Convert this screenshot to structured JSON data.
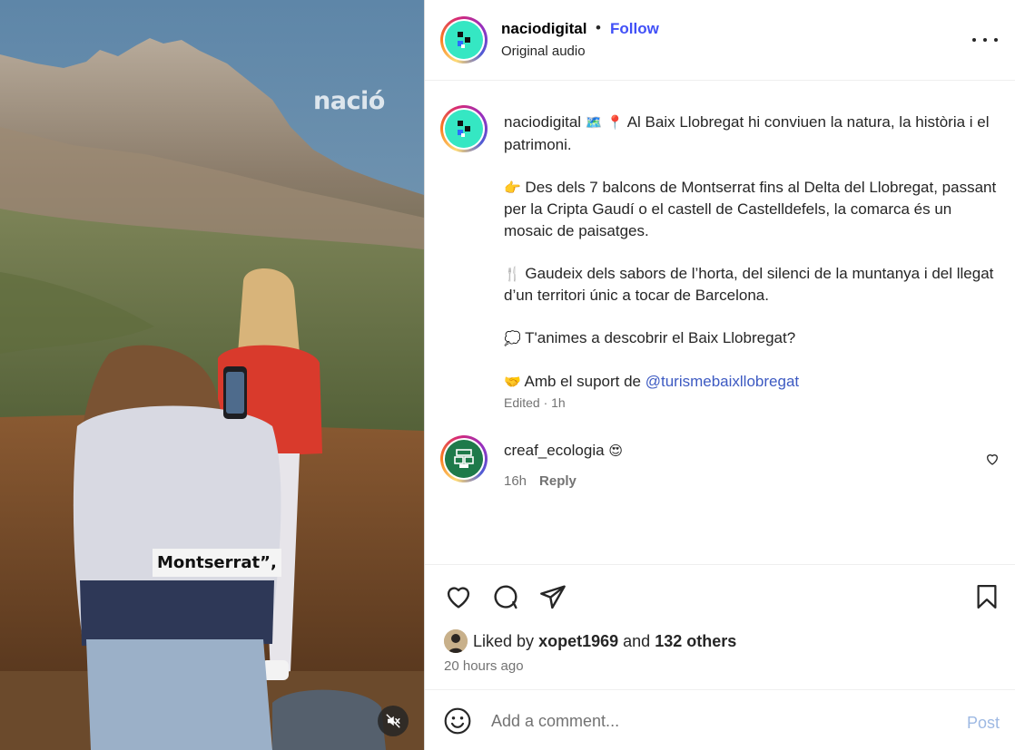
{
  "media": {
    "watermark": "nació",
    "caption": "Montserrat”,",
    "mute_icon": "speaker-muted-icon"
  },
  "header": {
    "username": "naciodigital",
    "separator": "•",
    "follow_label": "Follow",
    "audio_label": "Original audio",
    "more_icon": "more-horizontal-icon"
  },
  "post": {
    "username": "naciodigital",
    "line1_emojis": "🗺️ 📍",
    "line1_text": "Al Baix Llobregat hi conviuen la natura, la història i el patrimoni.",
    "para2_emoji": "👉",
    "para2_text": "Des dels 7 balcons de Montserrat fins al Delta del Llobregat, passant per la Cripta Gaudí o el castell de Castelldefels, la comarca és un mosaic de paisatges.",
    "para3_emoji": "🍴",
    "para3_text": "Gaudeix dels sabors de l’horta, del silenci de la muntanya i del llegat d’un territori únic a tocar de Barcelona.",
    "para4_emoji": "💭",
    "para4_text": "T'animes a descobrir el Baix Llobregat?",
    "para5_emoji": "🤝",
    "para5_text": "Amb el suport de",
    "para5_mention": "@turismebaixllobregat",
    "meta": "Edited · 1h"
  },
  "comment": {
    "username": "creaf_ecologia",
    "emoji": "😍",
    "time": "16h",
    "reply_label": "Reply",
    "like_icon": "heart-outline-icon"
  },
  "actions": {
    "like_icon": "heart-outline-icon",
    "comment_icon": "speech-bubble-icon",
    "share_icon": "paper-plane-icon",
    "save_icon": "bookmark-icon",
    "liked_prefix": "Liked by",
    "liked_user": "xopet1969",
    "liked_and": "and",
    "liked_others": "132 others",
    "time_ago": "20 hours ago"
  },
  "add_comment": {
    "emoji_icon": "smiley-icon",
    "placeholder": "Add a comment...",
    "post_label": "Post"
  },
  "colors": {
    "link_blue": "#4150f7",
    "brand_teal": "#35e7c3",
    "post_disabled": "#9eb9e3",
    "muted_text": "#737373"
  }
}
